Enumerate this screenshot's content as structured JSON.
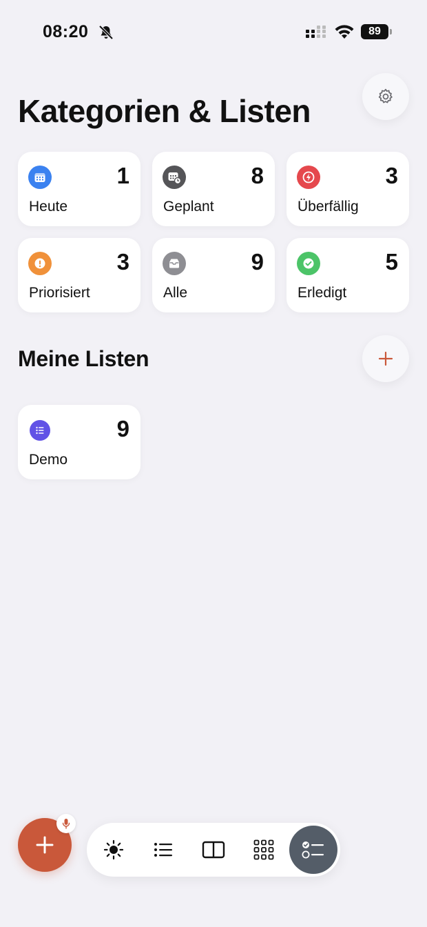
{
  "status_bar": {
    "time": "08:20",
    "battery": "89"
  },
  "header": {
    "title": "Kategorien & Listen"
  },
  "categories": [
    {
      "label": "Heute",
      "count": "1",
      "icon": "calendar-icon",
      "color": "#3b82f0"
    },
    {
      "label": "Geplant",
      "count": "8",
      "icon": "calendar-clock-icon",
      "color": "#555558"
    },
    {
      "label": "Überfällig",
      "count": "3",
      "icon": "lightning-icon",
      "color": "#e5484d"
    },
    {
      "label": "Priorisiert",
      "count": "3",
      "icon": "exclamation-icon",
      "color": "#f0913a"
    },
    {
      "label": "Alle",
      "count": "9",
      "icon": "tray-icon",
      "color": "#8e8e93"
    },
    {
      "label": "Erledigt",
      "count": "5",
      "icon": "checkmark-icon",
      "color": "#4cc468"
    }
  ],
  "lists_section": {
    "title": "Meine Listen"
  },
  "lists": [
    {
      "label": "Demo",
      "count": "9",
      "icon": "list-icon",
      "color": "#6152e6"
    }
  ],
  "colors": {
    "accent": "#c9583a",
    "background": "#f2f1f6",
    "active_tab": "#545d68"
  },
  "tabbar": {
    "tabs": [
      {
        "icon": "sun-icon",
        "active": false
      },
      {
        "icon": "list-bullets-icon",
        "active": false
      },
      {
        "icon": "split-view-icon",
        "active": false
      },
      {
        "icon": "grid-icon",
        "active": false
      },
      {
        "icon": "checklist-icon",
        "active": true
      }
    ]
  }
}
